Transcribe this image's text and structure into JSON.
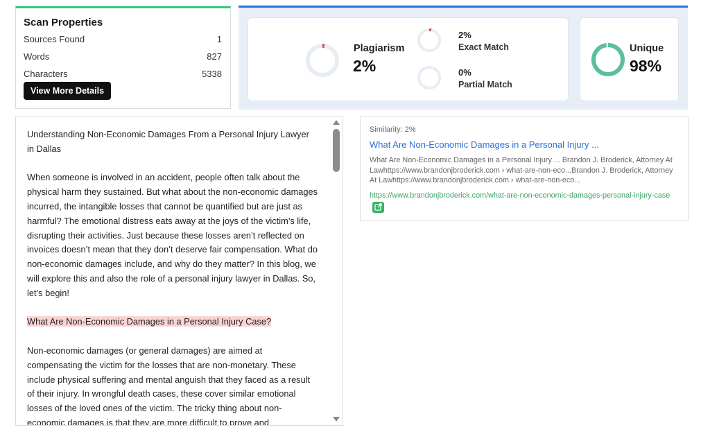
{
  "scan_properties": {
    "title": "Scan Properties",
    "rows": [
      {
        "label": "Sources Found",
        "value": "1"
      },
      {
        "label": "Words",
        "value": "827"
      },
      {
        "label": "Characters",
        "value": "5338"
      }
    ],
    "button_label": "View More Details"
  },
  "stats": {
    "plagiarism": {
      "label": "Plagiarism",
      "value": "2%",
      "percent": 2
    },
    "exact_match": {
      "label": "Exact Match",
      "value": "2%",
      "percent": 2
    },
    "partial_match": {
      "label": "Partial Match",
      "value": "0%",
      "percent": 0
    },
    "unique": {
      "label": "Unique",
      "value": "98%",
      "percent": 98
    }
  },
  "colors": {
    "plagiarism_red": "#d9534f",
    "unique_green": "#5bbf9a",
    "ring_track": "#e8edf3",
    "accent_blue": "#2a6fd6",
    "accent_green": "#2ecc71",
    "highlight": "#f9d4d2"
  },
  "document": {
    "paragraphs": [
      {
        "text": "Understanding Non-Economic Damages From a Personal Injury Lawyer in Dallas",
        "highlight": false
      },
      {
        "text": "When someone is involved in an accident, people often talk about the physical harm they sustained. But what about the non-economic damages incurred, the intangible losses that cannot be quantified but are just as harmful? The emotional distress eats away at the joys of the victim’s life, disrupting their activities. Just because these losses aren’t reflected on invoices doesn’t mean that they don’t deserve fair compensation. What do non-economic damages include, and why do they matter? In this blog, we will explore this and also the role of a personal injury lawyer in Dallas. So, let’s begin!",
        "highlight": false
      },
      {
        "text": "What Are Non-Economic Damages in a Personal Injury Case?",
        "highlight": true
      },
      {
        "text": "Non-economic damages (or general damages) are aimed at compensating the victim for the losses that are non-monetary. These include physical suffering and mental anguish that they faced as a result of their injury. In wrongful death cases, these cover similar emotional losses of the loved ones of the victim. The tricky thing about non-economic damages is that they are more difficult to prove and",
        "highlight": false
      }
    ]
  },
  "match": {
    "similarity": "Similarity: 2%",
    "title": "What Are Non-Economic Damages in a Personal Injury ...",
    "snippet": "What Are Non-Economic Damages in a Personal Injury ... Brandon J. Broderick, Attorney At Lawhttps://www.brandonjbroderick.com › what-are-non-eco...Brandon J. Broderick, Attorney At Lawhttps://www.brandonjbroderick.com › what-are-non-eco...",
    "url": "https://www.brandonjbroderick.com/what-are-non-economic-damages-personal-injury-case",
    "external_icon": "external-link-icon"
  }
}
